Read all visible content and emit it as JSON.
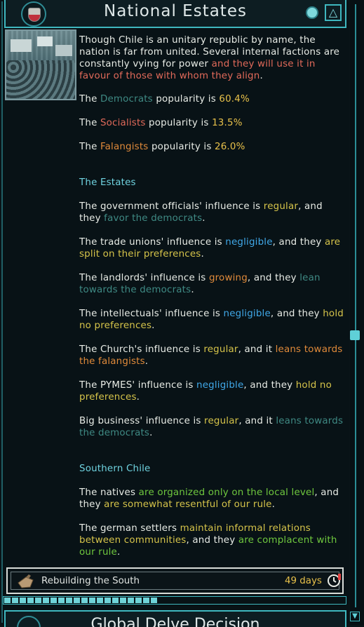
{
  "header": {
    "title": "National Estates",
    "emblem_icon": "chile-shield-icon",
    "icons": [
      "circle-toggle-icon",
      "triangle-icon"
    ]
  },
  "intro": {
    "part1": "Though Chile is an unitary republic by name, the nation is far from united. Several internal factions are constantly vying for power ",
    "part2": "and they will use it in favour of those with whom they align",
    "part3": "."
  },
  "popularity": [
    {
      "prefix": "The ",
      "party": "Democrats",
      "mid": " popularity is ",
      "value": "60.4%",
      "party_color": "#3f8a84"
    },
    {
      "prefix": "The ",
      "party": "Socialists",
      "mid": " popularity is ",
      "value": "13.5%",
      "party_color": "#e26a5a"
    },
    {
      "prefix": "The ",
      "party": "Falangists",
      "mid": " popularity is ",
      "value": "26.0%",
      "party_color": "#e08a3a"
    }
  ],
  "estates": {
    "title": "The Estates",
    "items": [
      {
        "a": "The government officials' influence is ",
        "level": "regular",
        "b": ", and they ",
        "pref": "favor the democrats",
        "c": "."
      },
      {
        "a": "The trade unions' influence is ",
        "level": "negligible",
        "b": ", and they ",
        "pref": "are split on their preferences",
        "c": "."
      },
      {
        "a": "The landlords' influence is ",
        "level": "growing",
        "b": ", and they ",
        "pref": "lean towards the democrats",
        "c": "."
      },
      {
        "a": "The intellectuals' influence is ",
        "level": "negligible",
        "b": ", and they ",
        "pref": "hold no preferences",
        "c": "."
      },
      {
        "a": "The Church's influence is ",
        "level": "regular",
        "b": ", and it ",
        "pref": "leans towards the falangists",
        "c": "."
      },
      {
        "a": "The PYMES' influence is ",
        "level": "negligible",
        "b": ", and they ",
        "pref": "hold no preferences",
        "c": "."
      },
      {
        "a": "Big business' influence is ",
        "level": "regular",
        "b": ", and it ",
        "pref": "leans towards the democrats",
        "c": "."
      }
    ]
  },
  "southern": {
    "title": "Southern Chile",
    "natives": {
      "a": "The natives ",
      "org": "are organized only on the local level",
      "b": ", and they ",
      "att": "are somewhat resentful of our rule",
      "c": "."
    },
    "settlers": {
      "a": "The german settlers ",
      "org": "maintain informal relations between communities",
      "b": ", and they ",
      "att": "are complacent with our rule",
      "c": "."
    }
  },
  "mission": {
    "label": "Rebuilding the South",
    "days": "49 days",
    "icon": "hand-tool-icon",
    "clock_icon": "clock-icon",
    "progress": 0.46
  },
  "next_panel": {
    "title": "Global Delve Decision"
  },
  "colors": {
    "accent": "#3fb8c0",
    "teal": "#3f8a84",
    "yellow": "#e8c14a",
    "blue": "#40a8e8",
    "salmon": "#e26a5a",
    "green": "#6fc83e"
  }
}
